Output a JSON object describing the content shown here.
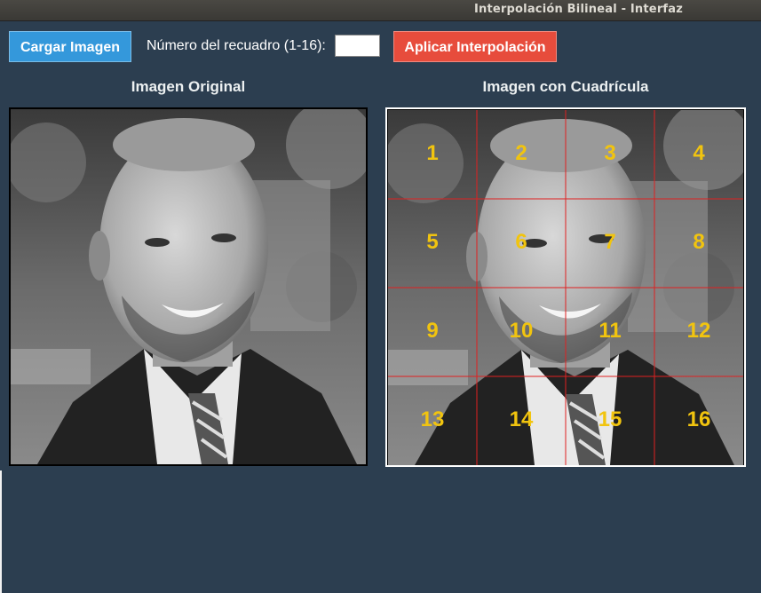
{
  "window": {
    "title": "Interpolación Bilineal - Interfaz"
  },
  "toolbar": {
    "load_label": "Cargar Imagen",
    "number_label": "Número del recuadro (1-16):",
    "number_value": "",
    "apply_label": "Aplicar Interpolación"
  },
  "panels": {
    "original_title": "Imagen Original",
    "grid_title": "Imagen con Cuadrícula"
  },
  "grid": {
    "rows": 4,
    "cols": 4,
    "line_color": "#e02020",
    "number_color": "#f1c40f",
    "cells": [
      "1",
      "2",
      "3",
      "4",
      "5",
      "6",
      "7",
      "8",
      "9",
      "10",
      "11",
      "12",
      "13",
      "14",
      "15",
      "16"
    ]
  },
  "colors": {
    "background": "#2c3e50",
    "load_button": "#3498db",
    "apply_button": "#e74c3c"
  }
}
